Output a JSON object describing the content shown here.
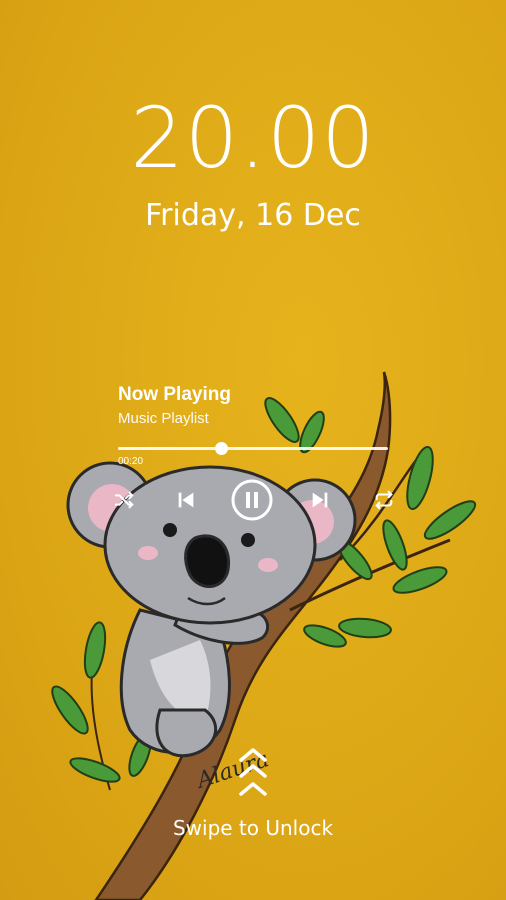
{
  "lockscreen": {
    "time": "20.00",
    "date": "Friday, 16 Dec"
  },
  "player": {
    "title": "Now Playing",
    "subtitle": "Music Playlist",
    "elapsed": "00:20",
    "progress": 0.38,
    "controls": [
      "shuffle-icon",
      "previous-icon",
      "pause-icon",
      "next-icon",
      "repeat-icon"
    ]
  },
  "unlock": {
    "label": "Swipe to Unlock"
  },
  "wallpaper": {
    "signature": "Alaura",
    "background_color": "#dda816",
    "koala_color": "#a9a9b0",
    "leaf_color": "#4a9a3a",
    "branch_color": "#8a5a2e"
  }
}
